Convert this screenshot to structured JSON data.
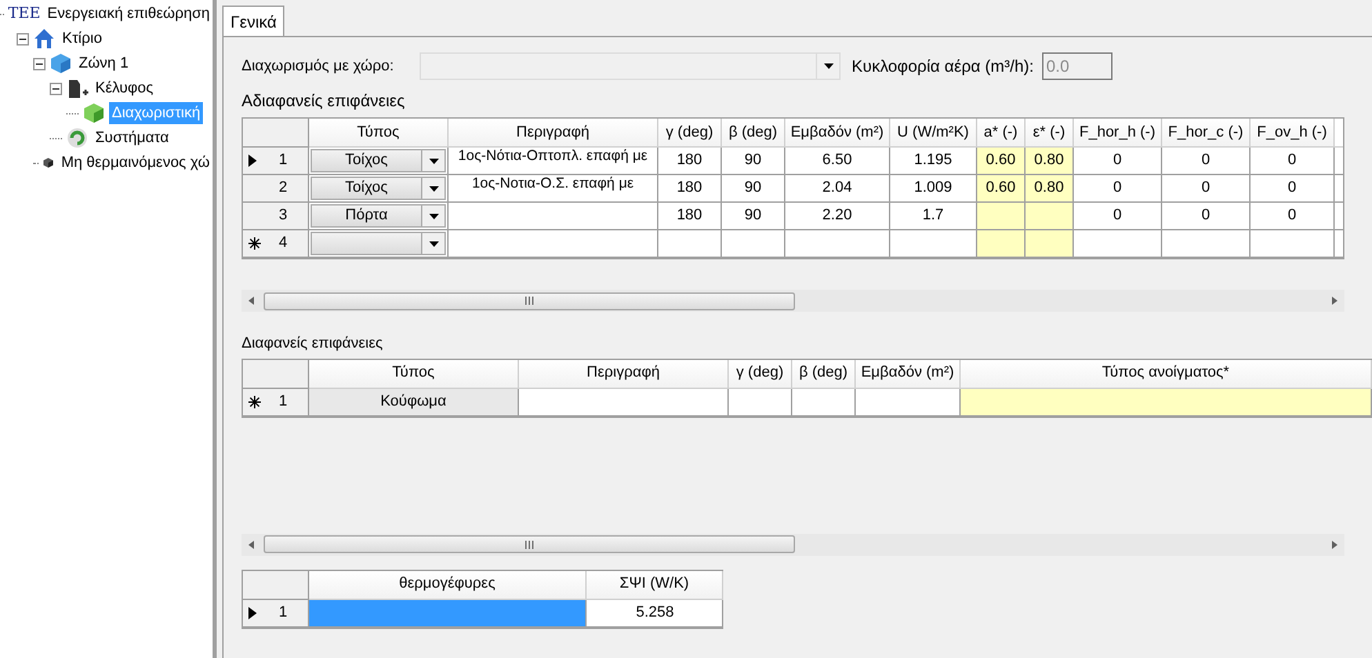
{
  "tree": [
    {
      "label": "Ενεργειακή επιθεώρηση",
      "logo": "TEE",
      "kind": "logo",
      "selected": false,
      "children": [
        {
          "label": "Κτίριο",
          "kind": "house",
          "expanded": true,
          "selected": false,
          "children": [
            {
              "label": "Ζώνη 1",
              "kind": "zone",
              "expanded": true,
              "selected": false,
              "children": [
                {
                  "label": "Κέλυφος",
                  "kind": "envelope",
                  "expanded": true,
                  "selected": false,
                  "children": [
                    {
                      "label": "Διαχωριστική",
                      "kind": "partition",
                      "selected": true
                    }
                  ]
                },
                {
                  "label": "Συστήματα",
                  "kind": "systems",
                  "selected": false
                }
              ]
            },
            {
              "label": "Μη θερμαινόμενος χώ",
              "kind": "unheated",
              "selected": false
            }
          ]
        }
      ]
    }
  ],
  "tabs": [
    {
      "label": "Γενικά",
      "selected": true
    }
  ],
  "form": {
    "partition_label": "Διαχωρισμός με χώρο:",
    "airflow_label": "Κυκλοφορία αέρα (m³/h):",
    "airflow_value": "0.0",
    "airflow_disabled": true
  },
  "opaque": {
    "title": "Αδιαφανείς επιφάνειες",
    "columns": [
      {
        "label": "Τύπος"
      },
      {
        "label": "Περιγραφή"
      },
      {
        "label": "γ (deg)"
      },
      {
        "label": "β (deg)"
      },
      {
        "label": "Εμβαδόν (m²)"
      },
      {
        "label": "U (W/m²K)"
      },
      {
        "label": "a* (-)",
        "highlight": true
      },
      {
        "label": "ε* (-)",
        "highlight": true
      },
      {
        "label": "F_hor_h (-)"
      },
      {
        "label": "F_hor_c (-)"
      },
      {
        "label": "F_ov_h (-)"
      }
    ],
    "rows": [
      {
        "kind": "current",
        "number": "1",
        "type": "Τοίχος",
        "cells": [
          "1ος-Νότια-Οπτοπλ. επαφή με",
          "180",
          "90",
          "6.50",
          "1.195",
          "0.60",
          "0.80",
          "0",
          "0",
          "0"
        ]
      },
      {
        "kind": "plain",
        "number": "2",
        "type": "Τοίχος",
        "cells": [
          "1ος-Νοτια-Ο.Σ. επαφή με",
          "180",
          "90",
          "2.04",
          "1.009",
          "0.60",
          "0.80",
          "0",
          "0",
          "0"
        ]
      },
      {
        "kind": "plain",
        "number": "3",
        "type": "Πόρτα",
        "cells": [
          null,
          "180",
          "90",
          "2.20",
          "1.7",
          null,
          null,
          "0",
          "0",
          "0"
        ]
      },
      {
        "kind": "new",
        "number": "4"
      }
    ]
  },
  "transparent": {
    "title": "Διαφανείς επιφάνειες",
    "columns": [
      {
        "label": "Τύπος"
      },
      {
        "label": "Περιγραφή"
      },
      {
        "label": "γ (deg)"
      },
      {
        "label": "β (deg)"
      },
      {
        "label": "Εμβαδόν (m²)"
      },
      {
        "label": "Τύπος ανοίγματος*",
        "highlight": true
      }
    ],
    "rows": [
      {
        "kind": "new",
        "number": "1",
        "type": "Κούφωμα"
      }
    ]
  },
  "bridges": {
    "columns": [
      {
        "label": "θερμογέφυρες"
      },
      {
        "label": "ΣΨΙ (W/K)"
      }
    ],
    "rows": [
      {
        "kind": "current",
        "number": "1",
        "name_selected": true,
        "value": "5.258"
      }
    ]
  }
}
